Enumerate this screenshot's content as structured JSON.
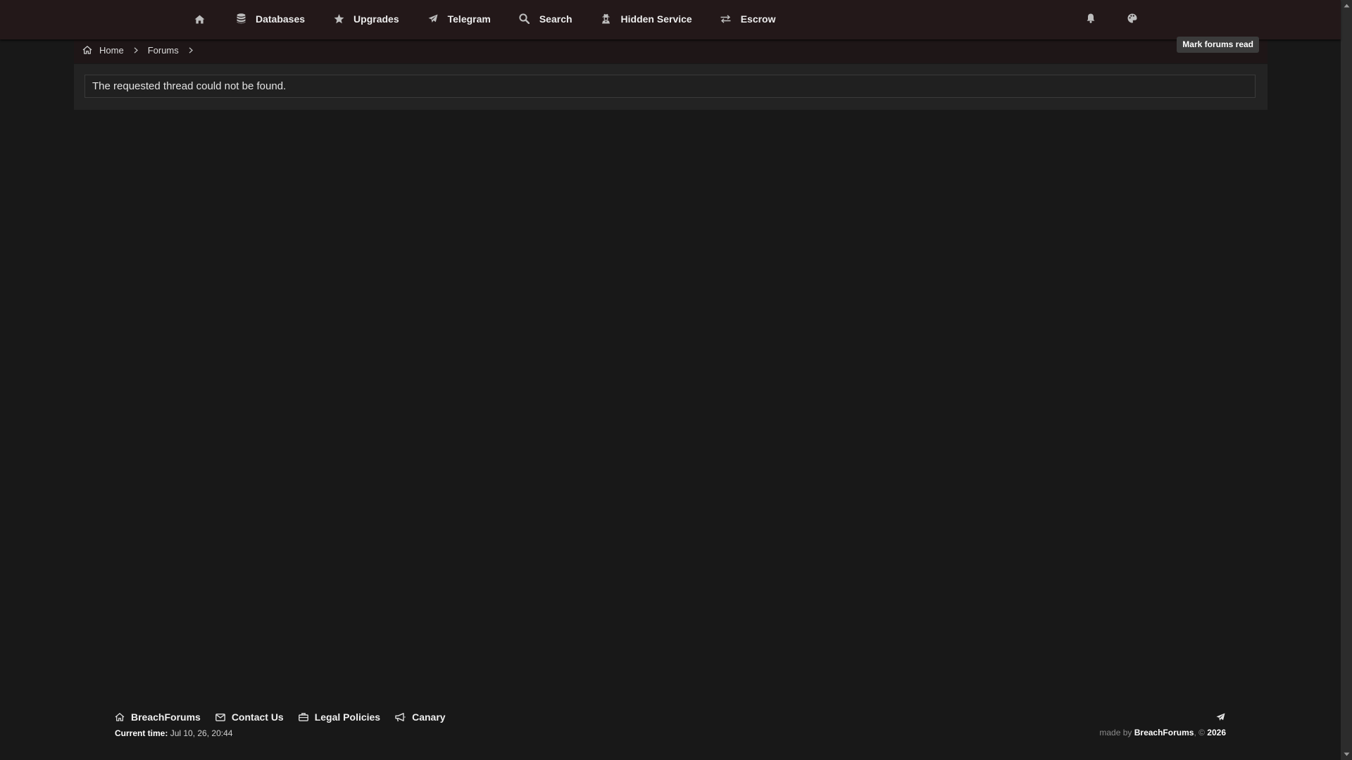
{
  "nav": {
    "home_icon": "home-icon",
    "items": [
      {
        "label": "Databases",
        "icon": "database-icon"
      },
      {
        "label": "Upgrades",
        "icon": "star-icon"
      },
      {
        "label": "Telegram",
        "icon": "paper-plane-icon"
      },
      {
        "label": "Search",
        "icon": "search-icon"
      },
      {
        "label": "Hidden Service",
        "icon": "user-secret-icon"
      },
      {
        "label": "Escrow",
        "icon": "exchange-icon"
      }
    ],
    "right_icons": [
      "bell-icon",
      "palette-icon"
    ]
  },
  "breadcrumb": {
    "home": "Home",
    "forums": "Forums"
  },
  "actions": {
    "mark_forums_read": "Mark forums read"
  },
  "main": {
    "error_message": "The requested thread could not be found."
  },
  "footer": {
    "links": [
      {
        "label": "BreachForums",
        "icon": "home-icon"
      },
      {
        "label": "Contact Us",
        "icon": "envelope-icon"
      },
      {
        "label": "Legal Policies",
        "icon": "briefcase-icon"
      },
      {
        "label": "Canary",
        "icon": "megaphone-icon"
      }
    ],
    "time_label": "Current time:",
    "time_value": "Jul 10, 26, 20:44",
    "made_by": "made by",
    "brand": "BreachForums",
    "copyright": ", ©",
    "year": "2026",
    "right_icon": "paper-plane-icon"
  },
  "colors": {
    "background": "#181818",
    "nav_background": "#231819",
    "panel_background": "#232323",
    "button_background": "#3b3b3b"
  }
}
